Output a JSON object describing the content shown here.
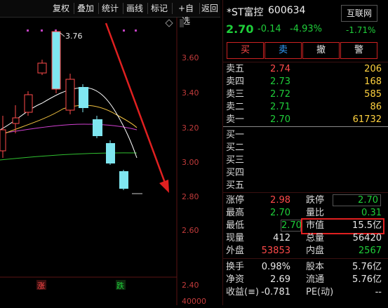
{
  "toolbar": {
    "items": [
      "复权",
      "叠加",
      "统计",
      "画线",
      "标记",
      "+自选",
      "返回"
    ]
  },
  "chart": {
    "y_ticks": [
      "3.60",
      "3.40",
      "3.20",
      "3.00",
      "2.80",
      "2.60",
      "2.40"
    ],
    "high_label": "3.76",
    "bottom_value": "40000",
    "marker_rise": "涨",
    "marker_fall": "跌"
  },
  "stock": {
    "name": "*ST富控",
    "code": "600634",
    "price": "2.70",
    "change": "-0.14",
    "change_pct": "-4.93%",
    "sector": "互联网",
    "sector_pct": "-1.71%"
  },
  "trade_buttons": [
    "买",
    "卖",
    "撤",
    "警"
  ],
  "order_book": {
    "asks": [
      {
        "label": "卖五",
        "price": "2.74",
        "vol": "206"
      },
      {
        "label": "卖四",
        "price": "2.73",
        "vol": "168"
      },
      {
        "label": "卖三",
        "price": "2.72",
        "vol": "585"
      },
      {
        "label": "卖二",
        "price": "2.71",
        "vol": "86"
      },
      {
        "label": "卖一",
        "price": "2.70",
        "vol": "61732"
      }
    ],
    "bids": [
      {
        "label": "买一"
      },
      {
        "label": "买二"
      },
      {
        "label": "买三"
      },
      {
        "label": "买四"
      },
      {
        "label": "买五"
      }
    ]
  },
  "stats": {
    "limit_up_label": "涨停",
    "limit_up": "2.98",
    "limit_down_label": "跌停",
    "limit_down": "2.70",
    "high_label": "最高",
    "high": "2.70",
    "vol_ratio_label": "量比",
    "vol_ratio": "0.31",
    "low_label": "最低",
    "low": "2.70",
    "mcap_label": "市值",
    "mcap": "15.5亿",
    "cur_vol_label": "现量",
    "cur_vol": "412",
    "total_vol_label": "总量",
    "total_vol": "56420",
    "outer_label": "外盘",
    "outer": "53853",
    "inner_label": "内盘",
    "inner": "2567",
    "turnover_label": "换手",
    "turnover": "0.98%",
    "shares_label": "股本",
    "shares": "5.76亿",
    "nav_label": "净资",
    "nav": "2.69",
    "float_label": "流通",
    "float": "5.76亿",
    "eps_label": "收益(≡)",
    "eps": "-0.781",
    "pe_label": "PE(动)",
    "pe": "--"
  },
  "colors": {
    "up": "#ff4a4a",
    "down": "#1fcf3a",
    "annotation": "#e02020",
    "ma5": "#ffffff",
    "ma10": "#f0c040",
    "ma20": "#d040d0",
    "ma60": "#30c030"
  }
}
